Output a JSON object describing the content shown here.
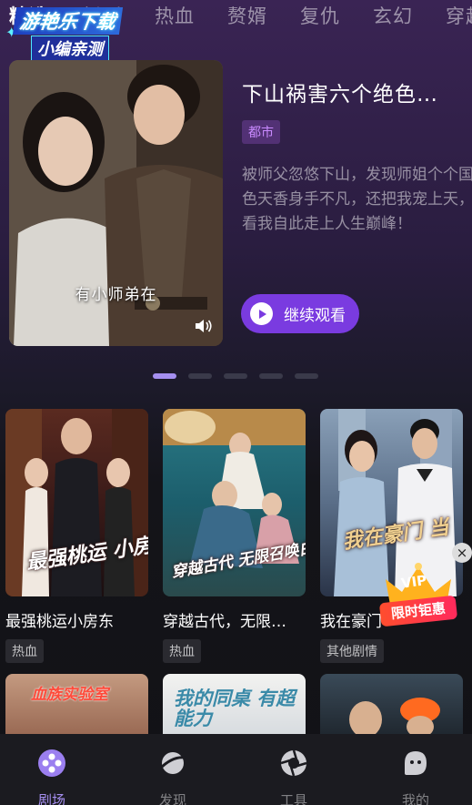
{
  "watermark": {
    "line1": "游艳乐下载",
    "line2": "小编亲测"
  },
  "tabs": [
    "精选",
    "新剧",
    "热血",
    "赘婿",
    "复仇",
    "玄幻",
    "穿越"
  ],
  "hero": {
    "title": "下山祸害六个绝色…",
    "tag": "都市",
    "description": "被师父忽悠下山，发现师姐个个国色天香身手不凡，还把我宠上天，看我自此走上人生巅峰！",
    "subtitle": "有小师弟在",
    "continue_label": "继续观看",
    "accent_color": "#7a3be0"
  },
  "carousel": {
    "count": 5,
    "active_index": 0
  },
  "cards": [
    {
      "title": "最强桃运小房东",
      "tag": "热血",
      "poster_text": "最强桃运 小房东"
    },
    {
      "title": "穿越古代，无限…",
      "tag": "热血",
      "poster_text": "穿越古代 无限召唤白粥"
    },
    {
      "title": "我在豪门",
      "tag": "其他剧情",
      "poster_text": "我在豪门 当"
    }
  ],
  "row2_posters": [
    "血族实验室",
    "我的同桌 有超能力",
    ""
  ],
  "vip_promo": {
    "badge": "VIP",
    "label": "限时钜惠",
    "close": "×"
  },
  "bottom_nav": [
    {
      "label": "剧场",
      "icon": "theater-icon",
      "active": true
    },
    {
      "label": "发现",
      "icon": "planet-icon",
      "active": false
    },
    {
      "label": "工具",
      "icon": "aperture-icon",
      "active": false
    },
    {
      "label": "我的",
      "icon": "profile-icon",
      "active": false
    }
  ]
}
